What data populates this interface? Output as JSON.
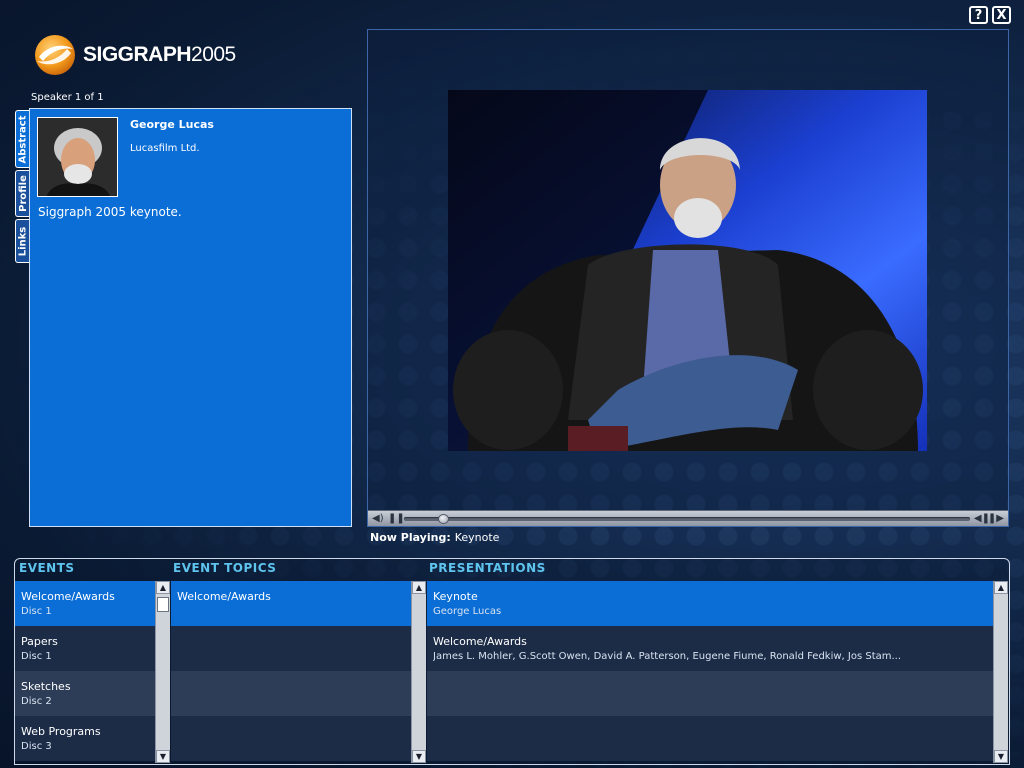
{
  "window": {
    "help_label": "?",
    "close_label": "X"
  },
  "logo": {
    "brand": "SIGGRAPH",
    "year": "2005"
  },
  "speaker_count": "Speaker 1 of 1",
  "tabs": [
    {
      "label": "Abstract",
      "active": true
    },
    {
      "label": "Profile",
      "active": false
    },
    {
      "label": "Links",
      "active": false
    }
  ],
  "speaker": {
    "name": "George Lucas",
    "organization": "Lucasfilm Ltd.",
    "abstract": "Siggraph 2005 keynote."
  },
  "player": {
    "now_playing_label": "Now Playing:",
    "now_playing_title": "Keynote",
    "volume_icon": "speaker-icon",
    "pause_icon": "pause-icon",
    "progress": 0.05
  },
  "columns": {
    "events": "EVENTS",
    "topics": "EVENT TOPICS",
    "presentations": "PRESENTATIONS"
  },
  "events": [
    {
      "title": "Welcome/Awards",
      "disc": "Disc 1",
      "selected": true
    },
    {
      "title": "Papers",
      "disc": "Disc 1",
      "selected": false
    },
    {
      "title": "Sketches",
      "disc": "Disc 2",
      "selected": false
    },
    {
      "title": "Web Programs",
      "disc": "Disc 3",
      "selected": false
    }
  ],
  "topics": [
    {
      "title": "Welcome/Awards",
      "selected": true
    }
  ],
  "presentations": [
    {
      "title": "Keynote",
      "speakers": "George Lucas",
      "selected": true
    },
    {
      "title": "Welcome/Awards",
      "speakers": "James L. Mohler, G.Scott Owen, David A. Patterson, Eugene Fiume, Ronald Fedkiw, Jos Stam...",
      "selected": false
    }
  ],
  "colors": {
    "accent_blue": "#0a6ed6",
    "header_cyan": "#5ec4ee",
    "background": "#0f2443"
  }
}
